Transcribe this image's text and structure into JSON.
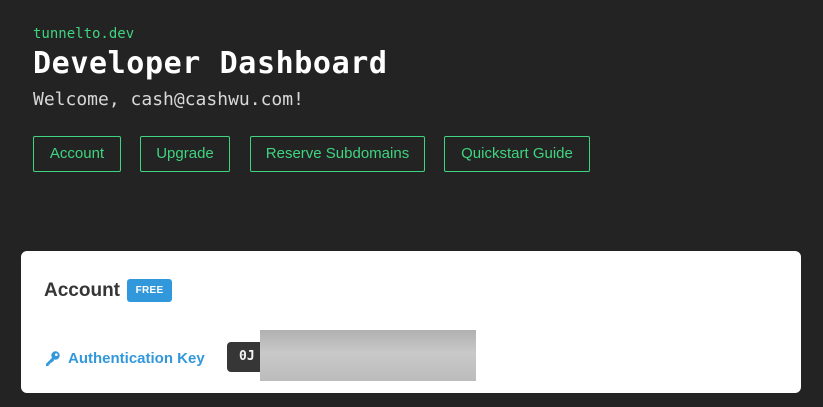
{
  "header": {
    "brand": "tunnelto.dev",
    "title": "Developer Dashboard",
    "welcome": "Welcome, cash@cashwu.com!"
  },
  "nav": {
    "buttons": [
      {
        "label": "Account"
      },
      {
        "label": "Upgrade"
      },
      {
        "label": "Reserve Subdomains"
      },
      {
        "label": "Quickstart Guide"
      }
    ]
  },
  "account_card": {
    "title": "Account",
    "tier_badge": "FREE",
    "auth_key_label": "Authentication Key",
    "auth_key_visible": "0J",
    "auth_key_redacted": true
  },
  "colors": {
    "background": "#232323",
    "accent_green": "#3fd47f",
    "link_blue": "#3298dc",
    "card_bg": "#ffffff",
    "key_box_bg": "#363636"
  },
  "icons": {
    "auth_key": "key-icon"
  }
}
